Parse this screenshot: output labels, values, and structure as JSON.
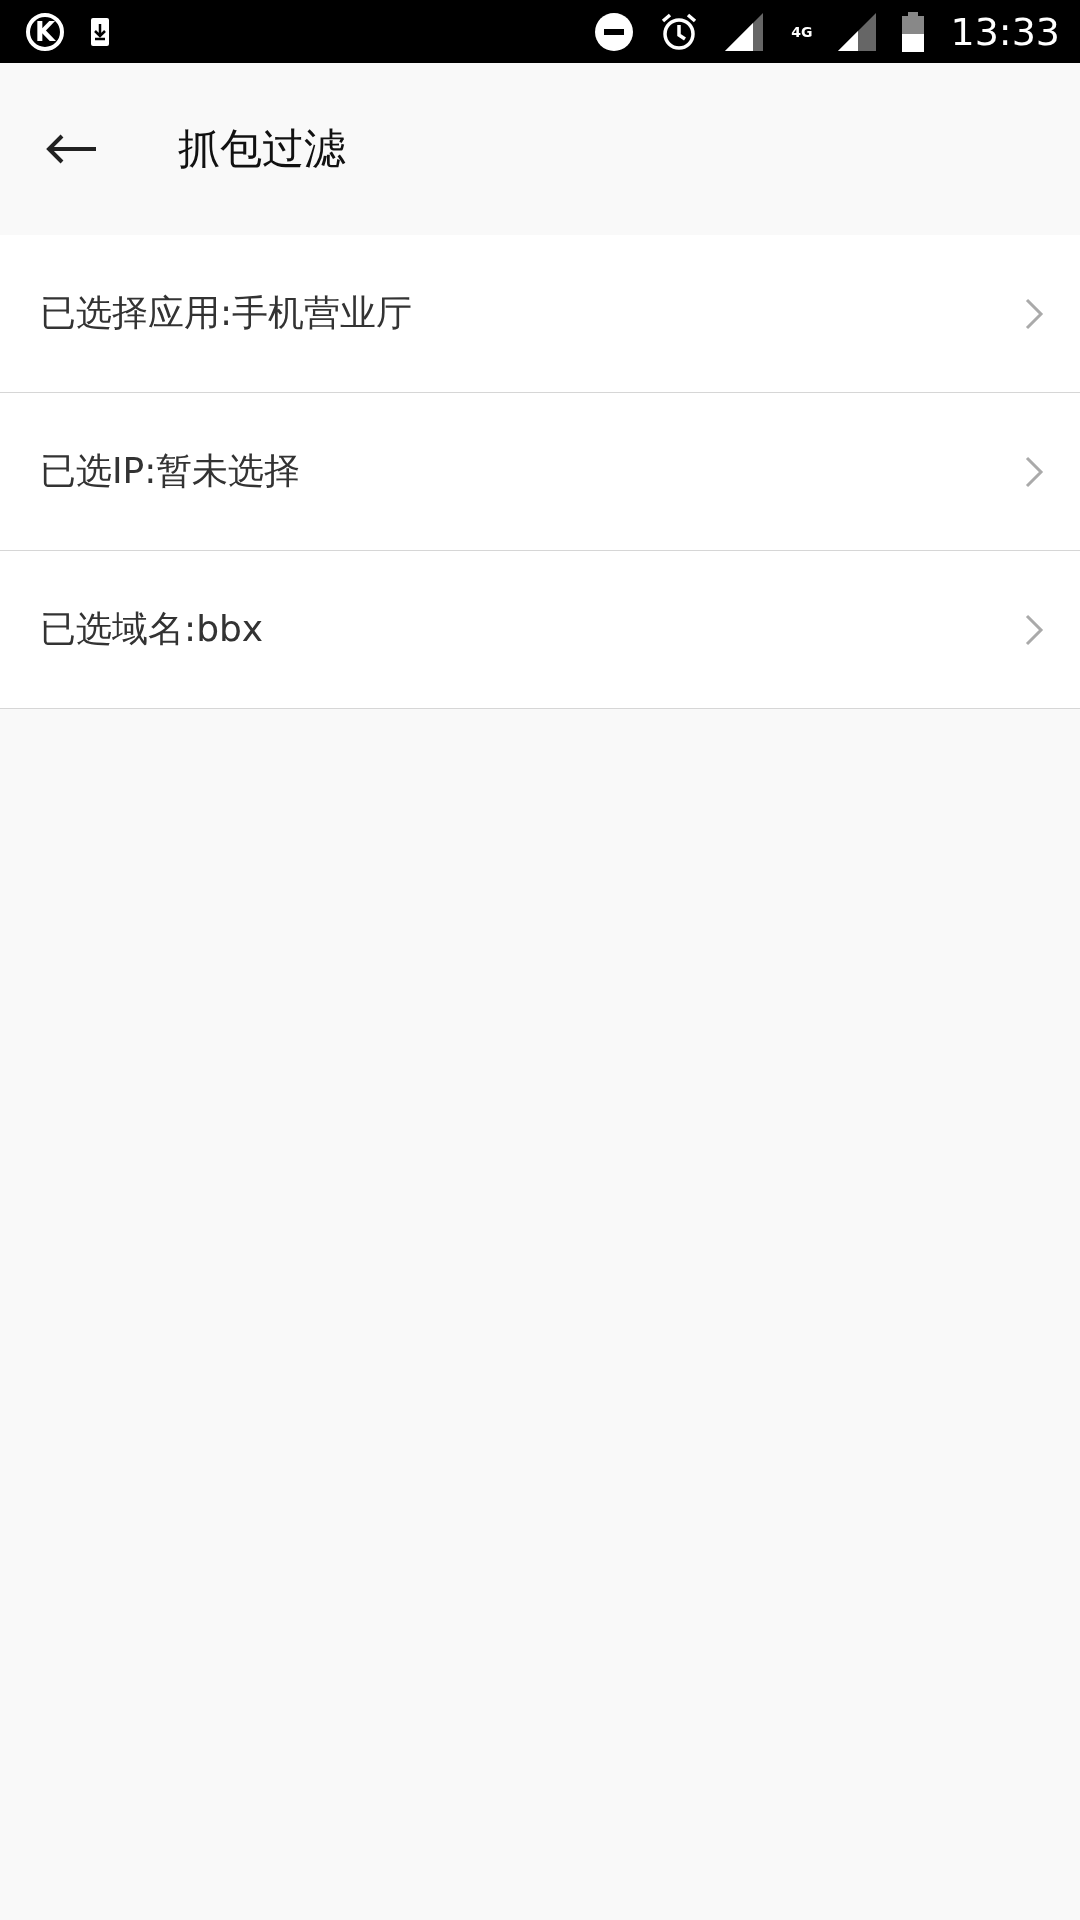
{
  "status_bar": {
    "app_letter": "K",
    "network": "4G",
    "time": "13:33"
  },
  "toolbar": {
    "title": "抓包过滤"
  },
  "rows": [
    {
      "label": "已选择应用:手机营业厅"
    },
    {
      "label": "已选IP:暂未选择"
    },
    {
      "label": "已选域名:bbx"
    }
  ]
}
